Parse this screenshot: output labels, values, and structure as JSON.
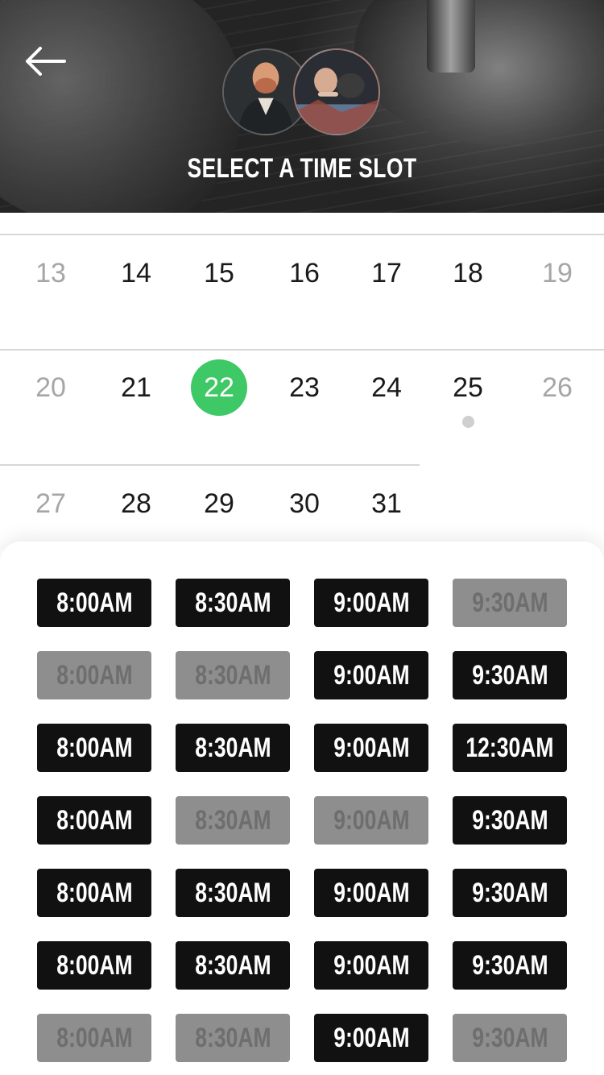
{
  "header": {
    "title": "SELECT A TIME SLOT"
  },
  "calendar": {
    "rows": [
      [
        {
          "day": "13",
          "muted": true
        },
        {
          "day": "14"
        },
        {
          "day": "15"
        },
        {
          "day": "16"
        },
        {
          "day": "17"
        },
        {
          "day": "18"
        },
        {
          "day": "19",
          "muted": true
        }
      ],
      [
        {
          "day": "20",
          "muted": true
        },
        {
          "day": "21"
        },
        {
          "day": "22",
          "selected": true
        },
        {
          "day": "23"
        },
        {
          "day": "24"
        },
        {
          "day": "25",
          "has_event": true
        },
        {
          "day": "26",
          "muted": true
        }
      ],
      [
        {
          "day": "27",
          "muted": true
        },
        {
          "day": "28"
        },
        {
          "day": "29"
        },
        {
          "day": "30"
        },
        {
          "day": "31"
        }
      ]
    ],
    "selected_color": "#3ec866"
  },
  "time_slots": [
    [
      "8:00AM",
      "8:30AM",
      "9:00AM",
      "9:30AM"
    ],
    [
      "8:00AM",
      "8:30AM",
      "9:00AM",
      "9:30AM"
    ],
    [
      "8:00AM",
      "8:30AM",
      "9:00AM",
      "12:30AM"
    ],
    [
      "8:00AM",
      "8:30AM",
      "9:00AM",
      "9:30AM"
    ],
    [
      "8:00AM",
      "8:30AM",
      "9:00AM",
      "9:30AM"
    ],
    [
      "8:00AM",
      "8:30AM",
      "9:00AM",
      "9:30AM"
    ],
    [
      "8:00AM",
      "8:30AM",
      "9:00AM",
      "9:30AM"
    ]
  ],
  "slot_availability": [
    [
      true,
      true,
      true,
      false
    ],
    [
      false,
      false,
      true,
      true
    ],
    [
      true,
      true,
      true,
      true
    ],
    [
      true,
      false,
      false,
      true
    ],
    [
      true,
      true,
      true,
      true
    ],
    [
      true,
      true,
      true,
      true
    ],
    [
      false,
      false,
      true,
      false
    ]
  ],
  "icons": {
    "back": "arrow-left-icon"
  }
}
